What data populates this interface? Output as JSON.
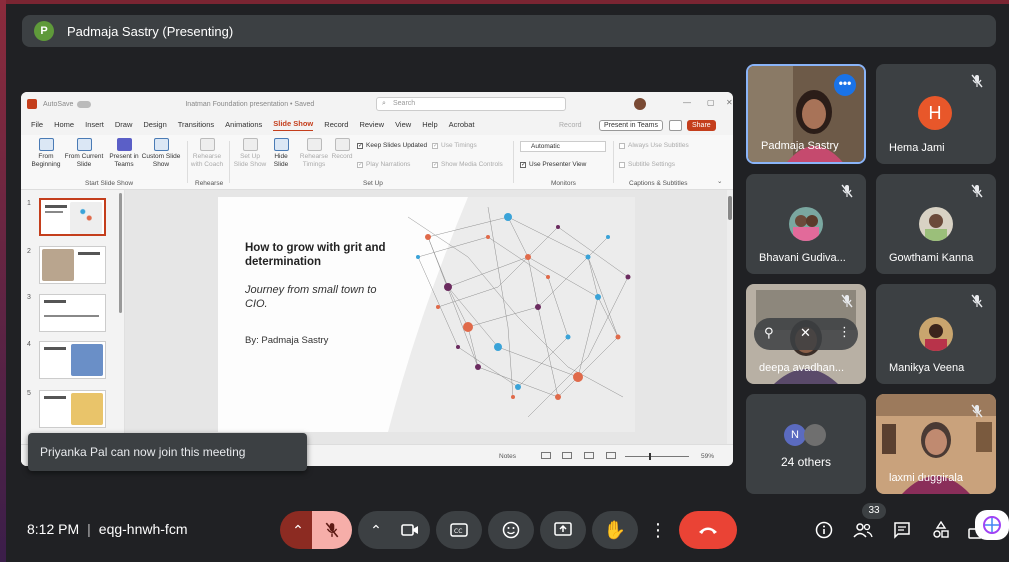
{
  "banner": {
    "avatar_letter": "P",
    "title": "Padmaja Sastry (Presenting)"
  },
  "ppt": {
    "autosave": "AutoSave",
    "doc_title": "Inatman Foundation presentation • Saved",
    "search_placeholder": "Search",
    "menus": [
      "File",
      "Home",
      "Insert",
      "Draw",
      "Design",
      "Transitions",
      "Animations",
      "Slide Show",
      "Record",
      "Review",
      "View",
      "Help",
      "Acrobat"
    ],
    "active_menu_index": 7,
    "record_label": "Record",
    "present_in_teams": "Present in Teams",
    "share_label": "Share",
    "ribbon": {
      "from_beginning": "From Beginning",
      "from_current": "From Current Slide",
      "present_teams": "Present in Teams",
      "custom_show": "Custom Slide Show",
      "rehearse_coach": "Rehearse with Coach",
      "setup_show": "Set Up Slide Show",
      "hide_slide": "Hide Slide",
      "rehearse_timings": "Rehearse Timings",
      "record": "Record",
      "keep_updated": "Keep Slides Updated",
      "play_narrations": "Play Narrations",
      "use_timings": "Use Timings",
      "show_media": "Show Media Controls",
      "monitor_select": "Automatic",
      "presenter_view": "Use Presenter View",
      "always_subtitles": "Always Use Subtitles",
      "subtitle_settings": "Subtitle Settings",
      "group_start": "Start Slide Show",
      "group_rehearse": "Rehearse",
      "group_setup": "Set Up",
      "group_monitors": "Monitors",
      "group_captions": "Captions & Subtitles"
    },
    "thumb_numbers": [
      "1",
      "2",
      "3",
      "4",
      "5"
    ],
    "slide": {
      "title": "How to grow with grit and determination",
      "subtitle": "Journey from small town to CIO.",
      "byline": "By: Padmaja Sastry"
    },
    "status": {
      "notes": "Notes",
      "zoom": "59%"
    }
  },
  "toast": {
    "message": "Priyanka Pal can now join this meeting"
  },
  "participants": [
    {
      "name": "Padmaja Sastry"
    },
    {
      "name": "Hema Jami",
      "initial": "H",
      "color": "#e8572a"
    },
    {
      "name": "Bhavani Gudiva..."
    },
    {
      "name": "Gowthami Kanna"
    },
    {
      "name": "deepa avadhan..."
    },
    {
      "name": "Manikya Veena"
    },
    {
      "name": "laxmi duggirala"
    }
  ],
  "others": {
    "initial": "N",
    "label": "24 others",
    "color": "#5b6bc0"
  },
  "bottom": {
    "time": "8:12 PM",
    "meeting_code": "eqg-hnwh-fcm",
    "participant_count": "33"
  }
}
